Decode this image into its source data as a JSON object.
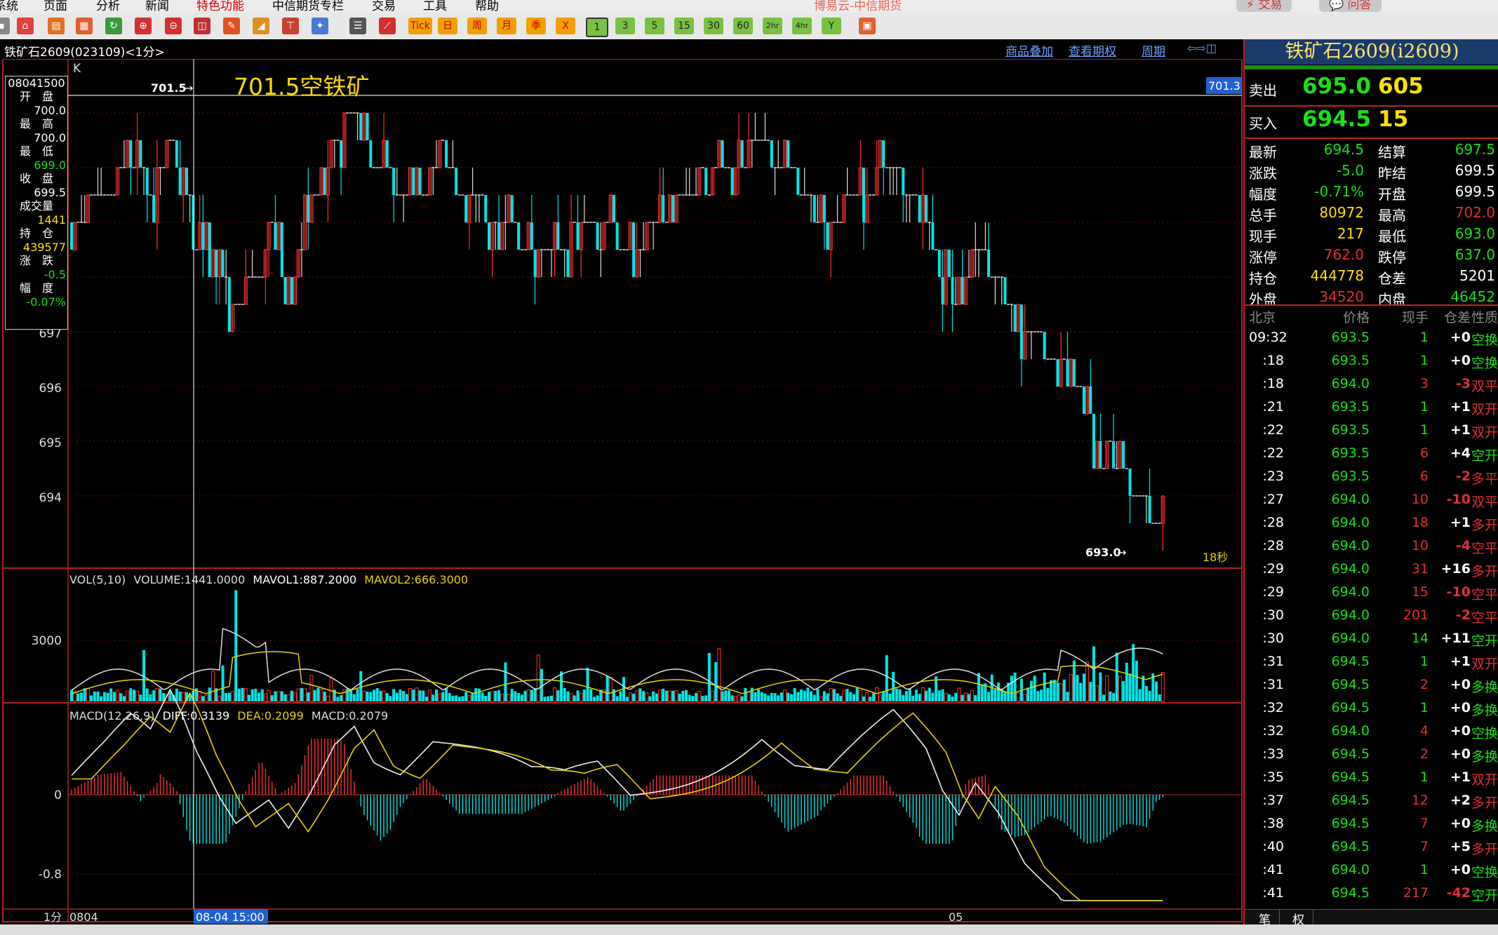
{
  "menu": [
    "系统",
    "页面",
    "分析",
    "新闻",
    "特色功能",
    "中信期货专栏",
    "交易",
    "工具",
    "帮助"
  ],
  "window_title": "博易云-中信期货",
  "top_buttons": {
    "trade": "交易",
    "ask": "问答"
  },
  "toolbar": {
    "timeframes": [
      "Tick",
      "日",
      "周",
      "月",
      "季",
      "X",
      "1",
      "3",
      "5",
      "15",
      "30",
      "60",
      "2hr",
      "4hr",
      "Y"
    ]
  },
  "chart_head": {
    "title": "铁矿石2609(023109)<1分>",
    "links": [
      "商品叠加",
      "查看期权",
      "周期"
    ]
  },
  "k": {
    "panel_label": "K",
    "annotation": "701.5空铁矿",
    "high_marker": "701.5",
    "low_marker": "693.0",
    "cursor_price": "701.3",
    "countdown": "18秒",
    "y_ticks": [
      "697",
      "696",
      "695",
      "694"
    ]
  },
  "info_box": {
    "time": "08041500",
    "rows": [
      {
        "label": "开　盘",
        "value": "700.0"
      },
      {
        "label": "最　高",
        "value": "700.0"
      },
      {
        "label": "最　低",
        "value": "699.0"
      },
      {
        "label": "收　盘",
        "value": "699.5"
      },
      {
        "label": "成交量",
        "value": "1441"
      },
      {
        "label": "持　仓",
        "value": "439577"
      },
      {
        "label": "涨　跌",
        "value": "-0.5"
      },
      {
        "label": "幅　度",
        "value": "-0.07%"
      }
    ]
  },
  "vol": {
    "title": "VOL(5,10)",
    "volume": "VOLUME:1441.0000",
    "mavol1": "MAVOL1:887.2000",
    "mavol2": "MAVOL2:666.3000",
    "y_tick": "3000"
  },
  "macd": {
    "title": "MACD(12,26,9)",
    "diff": "DIFF:0.3139",
    "dea": "DEA:0.2099",
    "macd": "MACD:0.2079",
    "y_ticks": [
      "0",
      "-0.8"
    ]
  },
  "x_axis": {
    "period": "1分",
    "start": "0804",
    "cursor": "08-04 15:00",
    "mid": "05"
  },
  "quote": {
    "title": "铁矿石2609(i2609)",
    "sell_label": "卖出",
    "sell_price": "695.0",
    "sell_qty": "605",
    "buy_label": "买入",
    "buy_price": "694.5",
    "buy_qty": "15",
    "stats": [
      [
        "最新",
        "694.5",
        "结算",
        "697.5"
      ],
      [
        "涨跌",
        "-5.0",
        "昨结",
        "699.5"
      ],
      [
        "幅度",
        "-0.71%",
        "开盘",
        "699.5"
      ],
      [
        "总手",
        "80972",
        "最高",
        "702.0"
      ],
      [
        "现手",
        "217",
        "最低",
        "693.0"
      ],
      [
        "涨停",
        "762.0",
        "跌停",
        "637.0"
      ],
      [
        "持仓",
        "444778",
        "仓差",
        "5201"
      ],
      [
        "外盘",
        "34520",
        "内盘",
        "46452"
      ]
    ],
    "tick_header": [
      "北京",
      "价格",
      "现手",
      "仓差",
      "性质"
    ],
    "ticks": [
      [
        "09:32",
        "693.5",
        "1",
        "+0",
        "空换"
      ],
      [
        ":18",
        "693.5",
        "1",
        "+0",
        "空换"
      ],
      [
        ":18",
        "694.0",
        "3",
        "-3",
        "双平"
      ],
      [
        ":21",
        "693.5",
        "1",
        "+1",
        "双开"
      ],
      [
        ":22",
        "693.5",
        "1",
        "+1",
        "双开"
      ],
      [
        ":22",
        "693.5",
        "6",
        "+4",
        "空开"
      ],
      [
        ":23",
        "693.5",
        "6",
        "-2",
        "多平"
      ],
      [
        ":27",
        "694.0",
        "10",
        "-10",
        "双平"
      ],
      [
        ":28",
        "694.0",
        "18",
        "+1",
        "多开"
      ],
      [
        ":28",
        "694.0",
        "10",
        "-4",
        "空平"
      ],
      [
        ":29",
        "694.0",
        "31",
        "+16",
        "多开"
      ],
      [
        ":29",
        "694.0",
        "15",
        "-10",
        "空平"
      ],
      [
        ":30",
        "694.0",
        "201",
        "-2",
        "空平"
      ],
      [
        ":30",
        "694.0",
        "14",
        "+11",
        "空开"
      ],
      [
        ":31",
        "694.5",
        "1",
        "+1",
        "双开"
      ],
      [
        ":31",
        "694.5",
        "2",
        "+0",
        "多换"
      ],
      [
        ":32",
        "694.5",
        "1",
        "+0",
        "多换"
      ],
      [
        ":32",
        "694.0",
        "4",
        "+0",
        "空换"
      ],
      [
        ":33",
        "694.5",
        "2",
        "+0",
        "多换"
      ],
      [
        ":35",
        "694.5",
        "1",
        "+1",
        "双开"
      ],
      [
        ":37",
        "694.5",
        "12",
        "+2",
        "多开"
      ],
      [
        ":38",
        "694.5",
        "7",
        "+0",
        "多换"
      ],
      [
        ":40",
        "694.5",
        "7",
        "+5",
        "多开"
      ],
      [
        ":41",
        "694.0",
        "1",
        "+0",
        "空换"
      ],
      [
        ":41",
        "694.5",
        "217",
        "-42",
        "空开"
      ]
    ],
    "bottom_tabs": [
      "笔",
      "权"
    ]
  }
}
